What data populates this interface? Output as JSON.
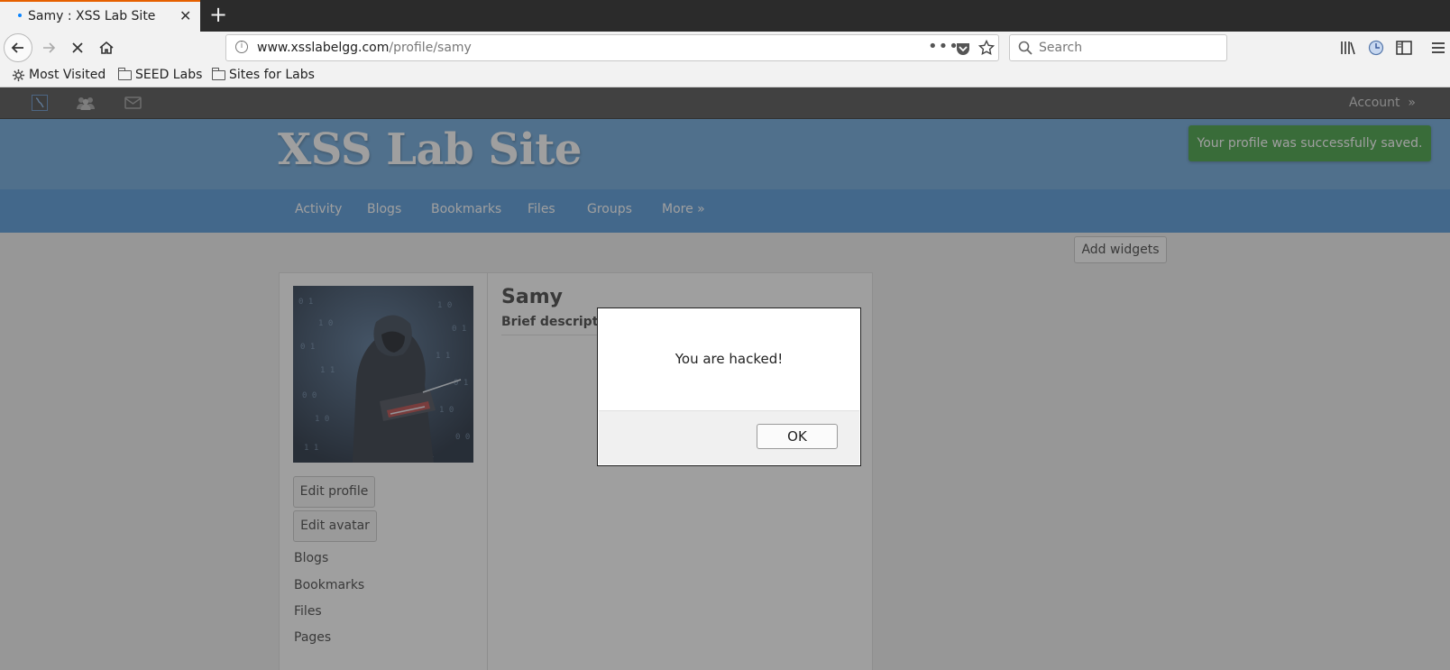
{
  "browser": {
    "tab_title": "Samy : XSS Lab Site",
    "url_host": "www.xsslabelgg.com",
    "url_path": "/profile/samy",
    "search_placeholder": "Search",
    "bookmarks": [
      "Most Visited",
      "SEED Labs",
      "Sites for Labs"
    ]
  },
  "site": {
    "account_label": "Account",
    "account_suffix": "»",
    "title": "XSS Lab Site",
    "success_message": "Your profile was successfully saved.",
    "menu": [
      "Activity",
      "Blogs",
      "Bookmarks",
      "Files",
      "Groups"
    ],
    "menu_more": "More »",
    "add_widgets": "Add widgets"
  },
  "profile": {
    "name": "Samy",
    "brief_description": "Brief descriptio",
    "edit_profile": "Edit profile",
    "edit_avatar": "Edit avatar",
    "links": [
      "Blogs",
      "Bookmarks",
      "Files",
      "Pages"
    ]
  },
  "dialog": {
    "message": "You are hacked!",
    "ok": "OK"
  },
  "colors": {
    "header_blue": "#60a0d8",
    "menu_blue": "#4690d6",
    "topbar_dark": "#424242",
    "success_green": "#339933",
    "overlay": "rgba(64,64,64,0.5)"
  }
}
